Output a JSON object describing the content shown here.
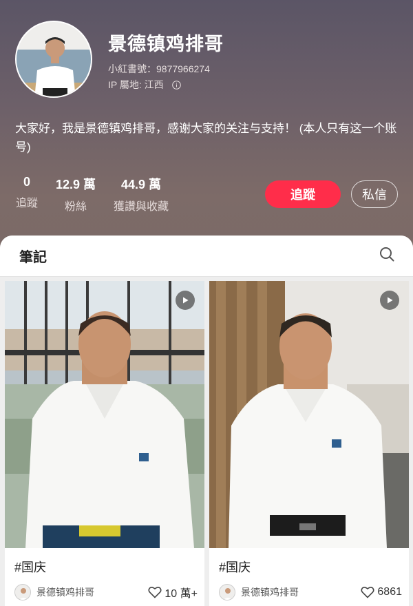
{
  "profile": {
    "username": "景德镇鸡排哥",
    "red_id": "小紅書號：9877966274",
    "ip_location": "IP 屬地: 江西",
    "bio": "大家好，我是景德镇鸡排哥，感谢大家的关注与支持！ (本人只有这一个账号)",
    "stats": [
      {
        "value": "0",
        "label": "追蹤"
      },
      {
        "value": "12.9 萬",
        "label": "粉絲"
      },
      {
        "value": "44.9 萬",
        "label": "獲讚與收藏"
      }
    ],
    "follow_label": "追蹤",
    "message_label": "私信"
  },
  "notes": {
    "tab_label": "筆記",
    "cards": [
      {
        "title": "#国庆",
        "author": "景德镇鸡排哥",
        "likes": "10 萬+"
      },
      {
        "title": "#国庆",
        "author": "景德镇鸡排哥",
        "likes": "6861"
      }
    ]
  },
  "colors": {
    "accent": "#ff2d4a",
    "header_top": "#5b5566",
    "header_bottom": "#7a6a66"
  }
}
